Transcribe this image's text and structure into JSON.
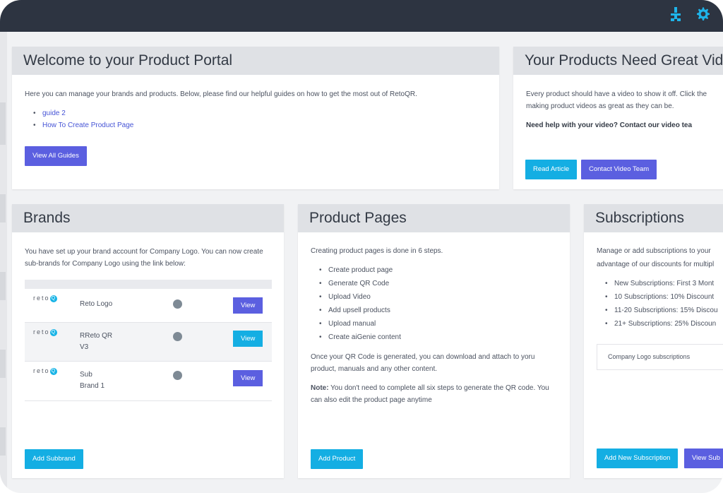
{
  "topbar": {
    "icons": [
      "portal-network-icon",
      "gear-icon"
    ]
  },
  "welcome": {
    "title": "Welcome to your Product Portal",
    "intro": "Here you can manage your brands and products. Below, please find our helpful guides on how to get the most out of RetoQR.",
    "guides": [
      "guide 2",
      "How To Create Product Page"
    ],
    "button": "View All Guides"
  },
  "videos": {
    "title": "Your Products Need Great Vid",
    "text": "Every product should have a video to show it off. Click the making product videos as great as they can be.",
    "text_line1": "Every product should have a video to show it off. Click the",
    "text_line2": "making product videos as great as they can be.",
    "help": "Need help with your video? Contact our video tea",
    "read_button": "Read Article",
    "contact_button": "Contact Video Team"
  },
  "brands": {
    "title": "Brands",
    "intro": "You have set up your brand account for Company Logo. You can now create sub-brands for Company Logo using the link below:",
    "logo_text": "reto",
    "logo_q": "Q",
    "rows": [
      {
        "name_line1": "Reto Logo",
        "name_line2": "",
        "view": "View"
      },
      {
        "name_line1": "RReto QR",
        "name_line2": "V3",
        "view": "View"
      },
      {
        "name_line1": "Sub",
        "name_line2": "Brand 1",
        "view": "View"
      }
    ],
    "add_button": "Add Subbrand"
  },
  "product_pages": {
    "title": "Product Pages",
    "intro": "Creating product pages is done in 6 steps.",
    "steps": [
      "Create product page",
      "Generate QR Code",
      "Upload Video",
      "Add upsell products",
      "Upload manual",
      "Create aiGenie content"
    ],
    "after": "Once your QR Code is generated, you can download and attach to yoru product, manuals and any other content.",
    "note_label": "Note:",
    "note": " You don't need to complete all six steps to generate the QR code. You can also edit the product page anytime",
    "add_button": "Add Product"
  },
  "subscriptions": {
    "title": "Subscriptions",
    "intro_line1": "Manage or add subscriptions to your",
    "intro_line2": "advantage of our discounts for multipl",
    "tiers": [
      "New Subscriptions: First 3 Mont",
      "10 Subscriptions: 10% Discount",
      "11-20 Subscriptions: 15% Discou",
      "21+ Subscriptions: 25% Discoun"
    ],
    "company_box": "Company Logo subscriptions",
    "add_button": "Add New Subscription",
    "view_button": "View Sub"
  },
  "colors": {
    "topbar": "#2d3441",
    "accent_indigo": "#5b5fe0",
    "accent_cyan": "#14aee3",
    "card_header": "#dfe1e5",
    "status_dot": "#7e8a95"
  }
}
